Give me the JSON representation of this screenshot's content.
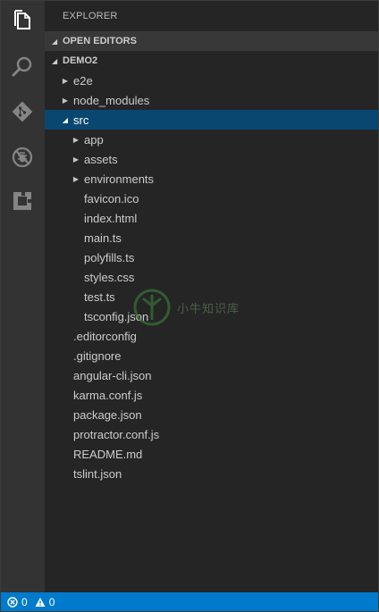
{
  "activity_bar": {
    "icons": [
      "files-icon",
      "search-icon",
      "git-icon",
      "debug-icon",
      "extensions-icon"
    ]
  },
  "sidebar": {
    "title": "EXPLORER",
    "sections": {
      "open_editors": "OPEN EDITORS",
      "project": "DEMO2"
    },
    "tree": [
      {
        "label": "e2e",
        "type": "folder",
        "expanded": false,
        "depth": 0
      },
      {
        "label": "node_modules",
        "type": "folder",
        "expanded": false,
        "depth": 0
      },
      {
        "label": "src",
        "type": "folder",
        "expanded": true,
        "depth": 0,
        "selected": true
      },
      {
        "label": "app",
        "type": "folder",
        "expanded": false,
        "depth": 1
      },
      {
        "label": "assets",
        "type": "folder",
        "expanded": false,
        "depth": 1
      },
      {
        "label": "environments",
        "type": "folder",
        "expanded": false,
        "depth": 1
      },
      {
        "label": "favicon.ico",
        "type": "file",
        "depth": 1
      },
      {
        "label": "index.html",
        "type": "file",
        "depth": 1
      },
      {
        "label": "main.ts",
        "type": "file",
        "depth": 1
      },
      {
        "label": "polyfills.ts",
        "type": "file",
        "depth": 1
      },
      {
        "label": "styles.css",
        "type": "file",
        "depth": 1
      },
      {
        "label": "test.ts",
        "type": "file",
        "depth": 1
      },
      {
        "label": "tsconfig.json",
        "type": "file",
        "depth": 1
      },
      {
        "label": ".editorconfig",
        "type": "file",
        "depth": 0
      },
      {
        "label": ".gitignore",
        "type": "file",
        "depth": 0
      },
      {
        "label": "angular-cli.json",
        "type": "file",
        "depth": 0
      },
      {
        "label": "karma.conf.js",
        "type": "file",
        "depth": 0
      },
      {
        "label": "package.json",
        "type": "file",
        "depth": 0
      },
      {
        "label": "protractor.conf.js",
        "type": "file",
        "depth": 0
      },
      {
        "label": "README.md",
        "type": "file",
        "depth": 0
      },
      {
        "label": "tslint.json",
        "type": "file",
        "depth": 0
      }
    ]
  },
  "status_bar": {
    "errors": "0",
    "warnings": "0",
    "color": "#007acc"
  },
  "watermark": {
    "text": "小牛知识库"
  }
}
